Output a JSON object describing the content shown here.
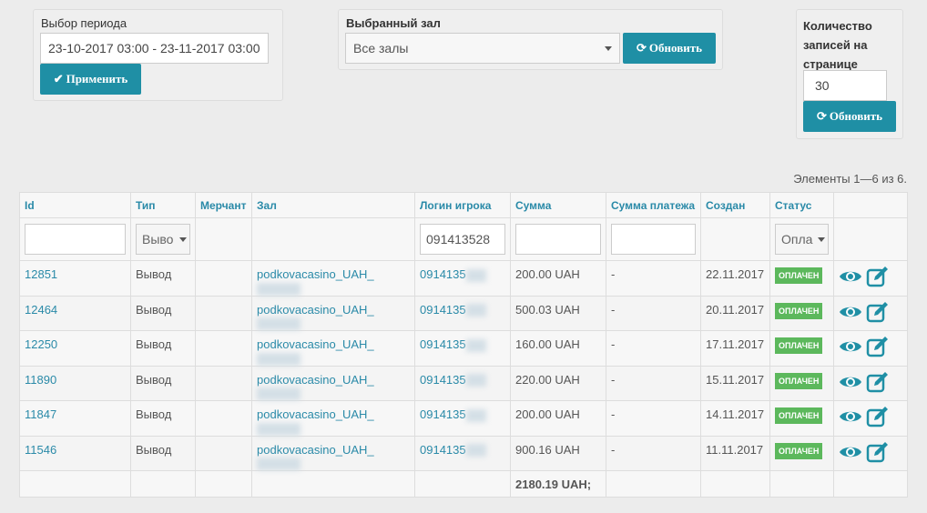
{
  "period": {
    "label": "Выбор периода",
    "value": "23-10-2017 03:00 - 23-11-2017 03:00",
    "apply": "Применить"
  },
  "hall": {
    "label": "Выбранный зал",
    "value": "Все залы",
    "refresh": "Обновить"
  },
  "perpage": {
    "label": "Количество записей на странице",
    "value": "30",
    "refresh": "Обновить"
  },
  "summary": "Элементы 1—6 из 6.",
  "columns": [
    "Id",
    "Тип",
    "Мерчант",
    "Зал",
    "Логин игрока",
    "Сумма",
    "Сумма платежа",
    "Создан",
    "Статус"
  ],
  "filters": {
    "type": "Выво",
    "login": "091413528",
    "status": "Опла"
  },
  "rows": [
    {
      "id": "12851",
      "type": "Вывод",
      "hall": "podkovacasino_UAH_",
      "login": "0914135",
      "sum": "200.00 UAH",
      "payment": "-",
      "created": "22.11.2017",
      "status": "ОПЛАЧЕН"
    },
    {
      "id": "12464",
      "type": "Вывод",
      "hall": "podkovacasino_UAH_",
      "login": "0914135",
      "sum": "500.03 UAH",
      "payment": "-",
      "created": "20.11.2017",
      "status": "ОПЛАЧЕН"
    },
    {
      "id": "12250",
      "type": "Вывод",
      "hall": "podkovacasino_UAH_",
      "login": "0914135",
      "sum": "160.00 UAH",
      "payment": "-",
      "created": "17.11.2017",
      "status": "ОПЛАЧЕН"
    },
    {
      "id": "11890",
      "type": "Вывод",
      "hall": "podkovacasino_UAH_",
      "login": "0914135",
      "sum": "220.00 UAH",
      "payment": "-",
      "created": "15.11.2017",
      "status": "ОПЛАЧЕН"
    },
    {
      "id": "11847",
      "type": "Вывод",
      "hall": "podkovacasino_UAH_",
      "login": "0914135",
      "sum": "200.00 UAH",
      "payment": "-",
      "created": "14.11.2017",
      "status": "ОПЛАЧЕН"
    },
    {
      "id": "11546",
      "type": "Вывод",
      "hall": "podkovacasino_UAH_",
      "login": "0914135",
      "sum": "900.16 UAH",
      "payment": "-",
      "created": "11.11.2017",
      "status": "ОПЛАЧЕН"
    }
  ],
  "total": "2180.19 UAH;"
}
